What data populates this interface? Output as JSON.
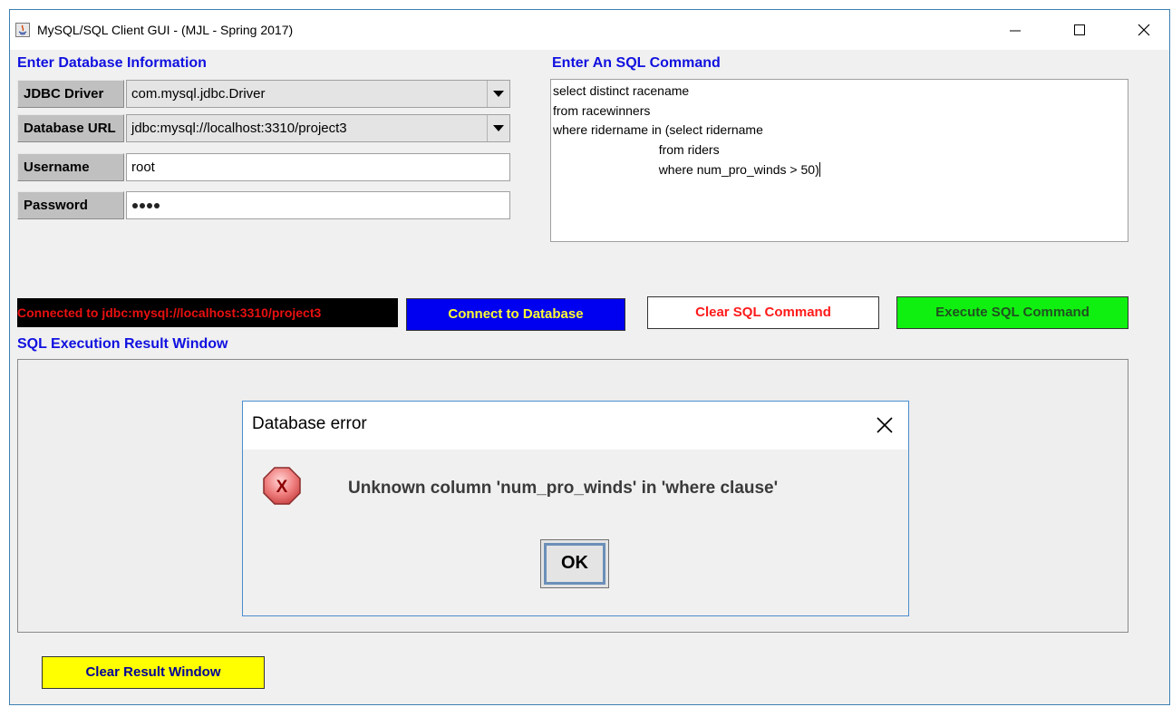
{
  "window": {
    "title": "MySQL/SQL Client GUI - (MJL - Spring 2017)",
    "controls": [
      "minimize-icon",
      "maximize-icon",
      "close-icon"
    ]
  },
  "database_info": {
    "heading": "Enter Database Information",
    "driver_label": "JDBC Driver",
    "driver_value": "com.mysql.jdbc.Driver",
    "url_label": "Database URL",
    "url_value": "jdbc:mysql://localhost:3310/project3",
    "username_label": "Username",
    "username_value": "root",
    "password_label": "Password",
    "password_mask_length": 4
  },
  "sql_command": {
    "heading": "Enter An SQL Command",
    "lines": [
      "select distinct racename",
      "from racewinners",
      "where ridername in (select ridername",
      "                              from riders",
      "                              where num_pro_winds > 50)"
    ]
  },
  "status": {
    "text": "Connected to jdbc:mysql://localhost:3310/project3",
    "text_color": "#e81010",
    "background": "#000000"
  },
  "buttons": {
    "connect": "Connect to Database",
    "clear_sql": "Clear SQL Command",
    "execute": "Execute SQL Command",
    "clear_result": "Clear Result Window"
  },
  "result": {
    "heading": "SQL Execution Result Window"
  },
  "dialog": {
    "title": "Database error",
    "message": "Unknown column 'num_pro_winds' in 'where clause'",
    "ok_label": "OK",
    "icon": "error-x-icon"
  },
  "colors": {
    "heading_blue": "#1010e0",
    "connect_bg": "#0000f0",
    "connect_fg": "#ffff33",
    "clear_sql_fg": "#ff1a1a",
    "execute_bg": "#10f010",
    "clear_result_bg": "#ffff00"
  }
}
